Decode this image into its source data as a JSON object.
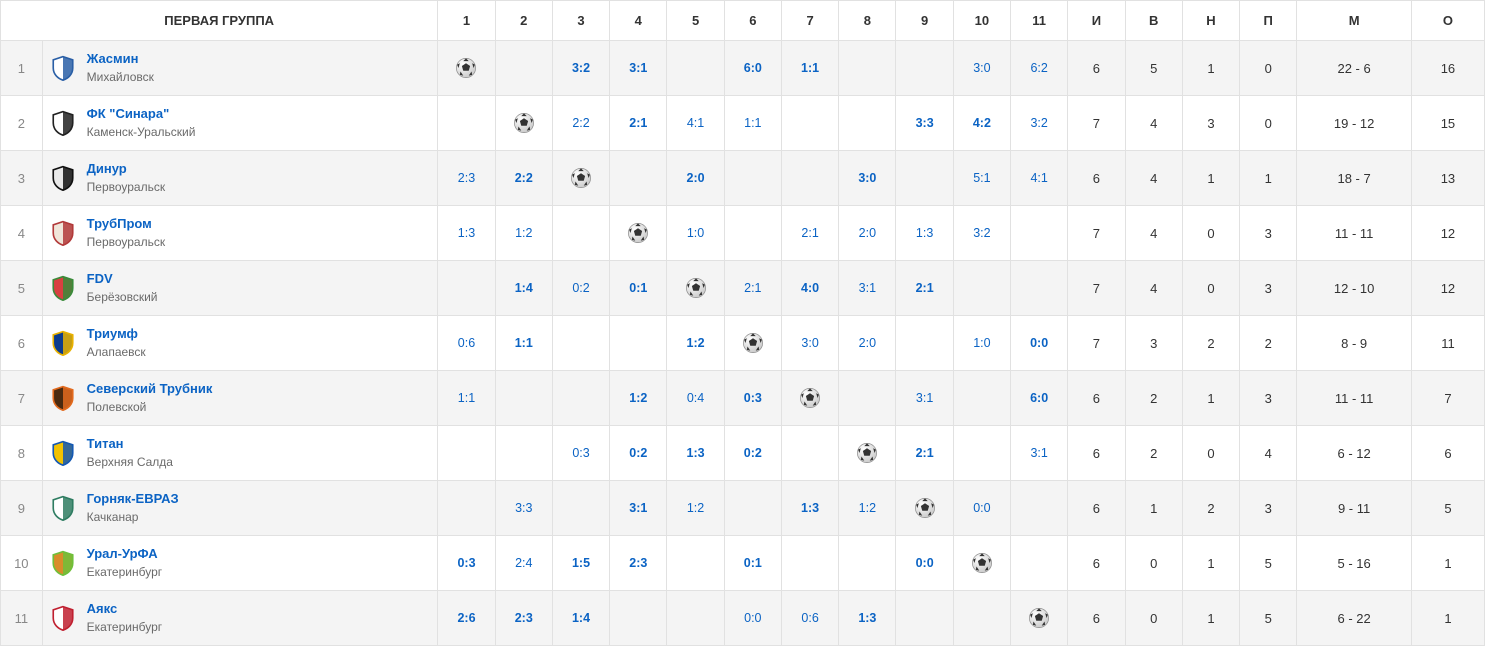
{
  "header": {
    "group_title": "ПЕРВАЯ ГРУППА",
    "num_cols": [
      "1",
      "2",
      "3",
      "4",
      "5",
      "6",
      "7",
      "8",
      "9",
      "10",
      "11"
    ],
    "stat_cols": [
      "И",
      "В",
      "Н",
      "П",
      "М",
      "О"
    ]
  },
  "teams": [
    {
      "rank": "1",
      "name": "Жасмин",
      "city": "Михайловск",
      "logo_colors": {
        "a": "#2a5fa6",
        "b": "#ffffff"
      },
      "scores": [
        "self",
        "",
        {
          "t": "3:2",
          "b": true
        },
        {
          "t": "3:1",
          "b": true
        },
        "",
        {
          "t": "6:0",
          "b": true
        },
        {
          "t": "1:1",
          "b": true
        },
        "",
        "",
        {
          "t": "3:0",
          "b": false
        },
        {
          "t": "6:2",
          "b": false
        }
      ],
      "stats": {
        "i": "6",
        "v": "5",
        "n": "1",
        "p": "0",
        "m": "22 - 6",
        "o": "16"
      }
    },
    {
      "rank": "2",
      "name": "ФК \"Синара\"",
      "city": "Каменск-Уральский",
      "logo_colors": {
        "a": "#222222",
        "b": "#ffffff"
      },
      "scores": [
        "",
        "self",
        {
          "t": "2:2",
          "b": false
        },
        {
          "t": "2:1",
          "b": true
        },
        {
          "t": "4:1",
          "b": false
        },
        {
          "t": "1:1",
          "b": false
        },
        "",
        "",
        {
          "t": "3:3",
          "b": true
        },
        {
          "t": "4:2",
          "b": true
        },
        {
          "t": "3:2",
          "b": false
        }
      ],
      "stats": {
        "i": "7",
        "v": "4",
        "n": "3",
        "p": "0",
        "m": "19 - 12",
        "o": "15"
      }
    },
    {
      "rank": "3",
      "name": "Динур",
      "city": "Первоуральск",
      "logo_colors": {
        "a": "#111111",
        "b": "#e9e9e9"
      },
      "scores": [
        {
          "t": "2:3",
          "b": false
        },
        {
          "t": "2:2",
          "b": true
        },
        "self",
        "",
        {
          "t": "2:0",
          "b": true
        },
        "",
        "",
        {
          "t": "3:0",
          "b": true
        },
        "",
        {
          "t": "5:1",
          "b": false
        },
        {
          "t": "4:1",
          "b": false
        }
      ],
      "stats": {
        "i": "6",
        "v": "4",
        "n": "1",
        "p": "1",
        "m": "18 - 7",
        "o": "13"
      }
    },
    {
      "rank": "4",
      "name": "ТрубПром",
      "city": "Первоуральск",
      "logo_colors": {
        "a": "#b23a3a",
        "b": "#f0e6da"
      },
      "scores": [
        {
          "t": "1:3",
          "b": false
        },
        {
          "t": "1:2",
          "b": false
        },
        "",
        "self",
        {
          "t": "1:0",
          "b": false
        },
        "",
        {
          "t": "2:1",
          "b": false
        },
        {
          "t": "2:0",
          "b": false
        },
        {
          "t": "1:3",
          "b": false
        },
        {
          "t": "3:2",
          "b": false
        },
        ""
      ],
      "stats": {
        "i": "7",
        "v": "4",
        "n": "0",
        "p": "3",
        "m": "11 - 11",
        "o": "12"
      }
    },
    {
      "rank": "5",
      "name": "FDV",
      "city": "Берёзовский",
      "logo_colors": {
        "a": "#3a8b3a",
        "b": "#d84040"
      },
      "scores": [
        "",
        {
          "t": "1:4",
          "b": true
        },
        {
          "t": "0:2",
          "b": false
        },
        {
          "t": "0:1",
          "b": true
        },
        "self",
        {
          "t": "2:1",
          "b": false
        },
        {
          "t": "4:0",
          "b": true
        },
        {
          "t": "3:1",
          "b": false
        },
        {
          "t": "2:1",
          "b": true
        },
        "",
        ""
      ],
      "stats": {
        "i": "7",
        "v": "4",
        "n": "0",
        "p": "3",
        "m": "12 - 10",
        "o": "12"
      }
    },
    {
      "rank": "6",
      "name": "Триумф",
      "city": "Алапаевск",
      "logo_colors": {
        "a": "#e8b100",
        "b": "#0b3b8e"
      },
      "scores": [
        {
          "t": "0:6",
          "b": false
        },
        {
          "t": "1:1",
          "b": true
        },
        "",
        "",
        {
          "t": "1:2",
          "b": true
        },
        "self",
        {
          "t": "3:0",
          "b": false
        },
        {
          "t": "2:0",
          "b": false
        },
        "",
        {
          "t": "1:0",
          "b": false
        },
        {
          "t": "0:0",
          "b": true
        }
      ],
      "stats": {
        "i": "7",
        "v": "3",
        "n": "2",
        "p": "2",
        "m": "8 - 9",
        "o": "11"
      }
    },
    {
      "rank": "7",
      "name": "Северский Трубник",
      "city": "Полевской",
      "logo_colors": {
        "a": "#e26a1e",
        "b": "#4a2a10"
      },
      "scores": [
        {
          "t": "1:1",
          "b": false
        },
        "",
        "",
        {
          "t": "1:2",
          "b": true
        },
        {
          "t": "0:4",
          "b": false
        },
        {
          "t": "0:3",
          "b": true
        },
        "self",
        "",
        {
          "t": "3:1",
          "b": false
        },
        "",
        {
          "t": "6:0",
          "b": true
        }
      ],
      "stats": {
        "i": "6",
        "v": "2",
        "n": "1",
        "p": "3",
        "m": "11 - 11",
        "o": "7"
      }
    },
    {
      "rank": "8",
      "name": "Титан",
      "city": "Верхняя Салда",
      "logo_colors": {
        "a": "#1458b3",
        "b": "#f2c200"
      },
      "scores": [
        "",
        "",
        {
          "t": "0:3",
          "b": false
        },
        {
          "t": "0:2",
          "b": true
        },
        {
          "t": "1:3",
          "b": true
        },
        {
          "t": "0:2",
          "b": true
        },
        "",
        "self",
        {
          "t": "2:1",
          "b": true
        },
        "",
        {
          "t": "3:1",
          "b": false
        }
      ],
      "stats": {
        "i": "6",
        "v": "2",
        "n": "0",
        "p": "4",
        "m": "6 - 12",
        "o": "6"
      }
    },
    {
      "rank": "9",
      "name": "Горняк-ЕВРАЗ",
      "city": "Качканар",
      "logo_colors": {
        "a": "#2f7d62",
        "b": "#ffffff"
      },
      "scores": [
        "",
        {
          "t": "3:3",
          "b": false
        },
        "",
        {
          "t": "3:1",
          "b": true
        },
        {
          "t": "1:2",
          "b": false
        },
        "",
        {
          "t": "1:3",
          "b": true
        },
        {
          "t": "1:2",
          "b": false
        },
        "self",
        {
          "t": "0:0",
          "b": false
        },
        ""
      ],
      "stats": {
        "i": "6",
        "v": "1",
        "n": "2",
        "p": "3",
        "m": "9 - 11",
        "o": "5"
      }
    },
    {
      "rank": "10",
      "name": "Урал-УрФА",
      "city": "Екатеринбург",
      "logo_colors": {
        "a": "#6fbf3a",
        "b": "#d98c2a"
      },
      "scores": [
        {
          "t": "0:3",
          "b": true
        },
        {
          "t": "2:4",
          "b": false
        },
        {
          "t": "1:5",
          "b": true
        },
        {
          "t": "2:3",
          "b": true
        },
        "",
        {
          "t": "0:1",
          "b": true
        },
        "",
        "",
        {
          "t": "0:0",
          "b": true
        },
        "self",
        ""
      ],
      "stats": {
        "i": "6",
        "v": "0",
        "n": "1",
        "p": "5",
        "m": "5 - 16",
        "o": "1"
      }
    },
    {
      "rank": "11",
      "name": "Аякс",
      "city": "Екатеринбург",
      "logo_colors": {
        "a": "#c02030",
        "b": "#ffffff"
      },
      "scores": [
        {
          "t": "2:6",
          "b": true
        },
        {
          "t": "2:3",
          "b": true
        },
        {
          "t": "1:4",
          "b": true
        },
        "",
        "",
        {
          "t": "0:0",
          "b": false
        },
        {
          "t": "0:6",
          "b": false
        },
        {
          "t": "1:3",
          "b": true
        },
        "",
        "",
        "self"
      ],
      "stats": {
        "i": "6",
        "v": "0",
        "n": "1",
        "p": "5",
        "m": "6 - 22",
        "o": "1"
      }
    }
  ]
}
